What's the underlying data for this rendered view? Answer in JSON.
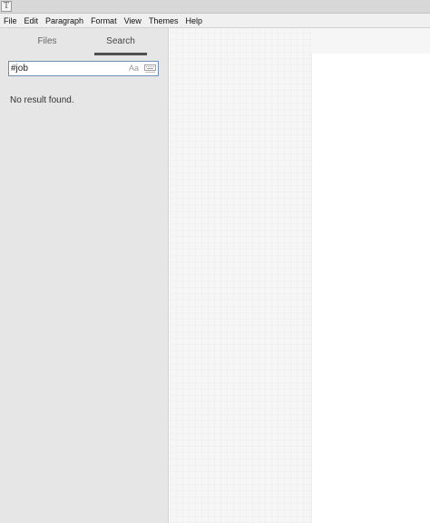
{
  "app": {
    "icon_letter": "T"
  },
  "menu": [
    "File",
    "Edit",
    "Paragraph",
    "Format",
    "View",
    "Themes",
    "Help"
  ],
  "sidebar": {
    "tabs": {
      "files": "Files",
      "search": "Search",
      "active": "search"
    },
    "search": {
      "value": "#job",
      "case_toggle": "Aa"
    },
    "result_message": "No result found."
  },
  "icons": {
    "app": "typora-app-icon",
    "case": "match-case-icon",
    "regex": "regex-keyboard-icon"
  }
}
